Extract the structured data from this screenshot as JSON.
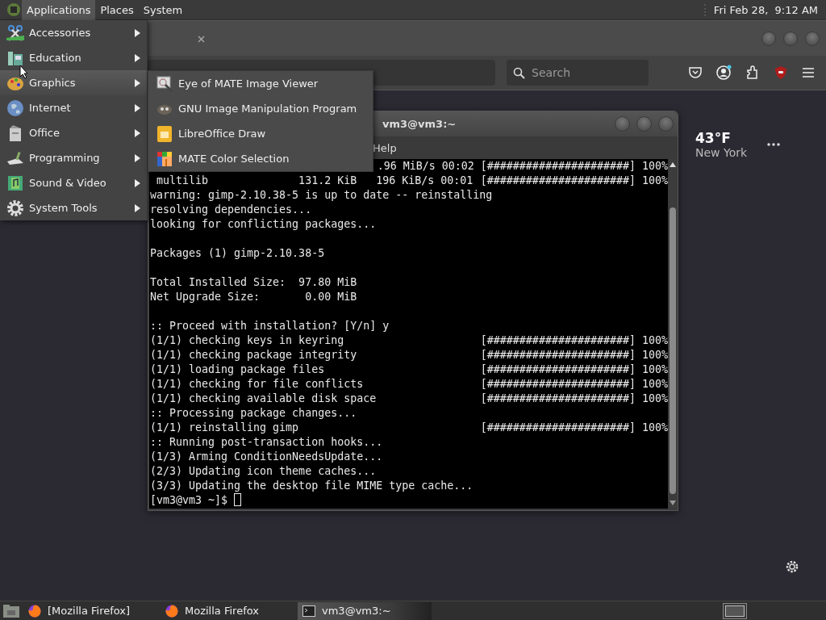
{
  "top_panel": {
    "menus": [
      {
        "label": "Applications",
        "selected": true
      },
      {
        "label": "Places",
        "selected": false
      },
      {
        "label": "System",
        "selected": false
      }
    ],
    "clock": "Fri Feb 28,  9:12 AM"
  },
  "browser": {
    "search": {
      "placeholder": "Search"
    },
    "weather": {
      "temperature": "43°F",
      "city": "New York"
    }
  },
  "terminal": {
    "title": "vm3@vm3:~",
    "menu": [
      "Help"
    ],
    "lines": [
      {
        "kind": "partial",
        "text": ".96 MiB/s 00:02",
        "progress": "[######################] 100%"
      },
      {
        "kind": "progress",
        "text": " multilib              131.2 KiB   196 KiB/s 00:01",
        "progress": "[######################] 100%"
      },
      {
        "kind": "plain",
        "text": "warning: gimp-2.10.38-5 is up to date -- reinstalling"
      },
      {
        "kind": "plain",
        "text": "resolving dependencies..."
      },
      {
        "kind": "plain",
        "text": "looking for conflicting packages..."
      },
      {
        "kind": "blank"
      },
      {
        "kind": "plain",
        "text": "Packages (1) gimp-2.10.38-5"
      },
      {
        "kind": "blank"
      },
      {
        "kind": "plain",
        "text": "Total Installed Size:  97.80 MiB"
      },
      {
        "kind": "plain",
        "text": "Net Upgrade Size:       0.00 MiB"
      },
      {
        "kind": "blank"
      },
      {
        "kind": "plain",
        "text": ":: Proceed with installation? [Y/n] y"
      },
      {
        "kind": "progress",
        "text": "(1/1) checking keys in keyring",
        "progress": "[######################] 100%"
      },
      {
        "kind": "progress",
        "text": "(1/1) checking package integrity",
        "progress": "[######################] 100%"
      },
      {
        "kind": "progress",
        "text": "(1/1) loading package files",
        "progress": "[######################] 100%"
      },
      {
        "kind": "progress",
        "text": "(1/1) checking for file conflicts",
        "progress": "[######################] 100%"
      },
      {
        "kind": "progress",
        "text": "(1/1) checking available disk space",
        "progress": "[######################] 100%"
      },
      {
        "kind": "plain",
        "text": ":: Processing package changes..."
      },
      {
        "kind": "progress",
        "text": "(1/1) reinstalling gimp",
        "progress": "[######################] 100%"
      },
      {
        "kind": "plain",
        "text": ":: Running post-transaction hooks..."
      },
      {
        "kind": "plain",
        "text": "(1/3) Arming ConditionNeedsUpdate..."
      },
      {
        "kind": "plain",
        "text": "(2/3) Updating icon theme caches..."
      },
      {
        "kind": "plain",
        "text": "(3/3) Updating the desktop file MIME type cache..."
      }
    ],
    "prompt": "[vm3@vm3 ~]$"
  },
  "applications_menu": {
    "items": [
      {
        "label": "Accessories",
        "selected": false
      },
      {
        "label": "Education",
        "selected": false
      },
      {
        "label": "Graphics",
        "selected": true
      },
      {
        "label": "Internet",
        "selected": false
      },
      {
        "label": "Office",
        "selected": false
      },
      {
        "label": "Programming",
        "selected": false
      },
      {
        "label": "Sound & Video",
        "selected": false
      },
      {
        "label": "System Tools",
        "selected": false
      }
    ],
    "submenu": [
      "Eye of MATE Image Viewer",
      "GNU Image Manipulation Program",
      "LibreOffice Draw",
      "MATE Color Selection"
    ]
  },
  "taskbar": {
    "tasks": [
      {
        "label": "[Mozilla Firefox]",
        "kind": "browser",
        "selected": false
      },
      {
        "label": "Mozilla Firefox",
        "kind": "browser",
        "selected": false
      },
      {
        "label": "vm3@vm3:~",
        "kind": "terminal",
        "selected": true
      }
    ]
  }
}
